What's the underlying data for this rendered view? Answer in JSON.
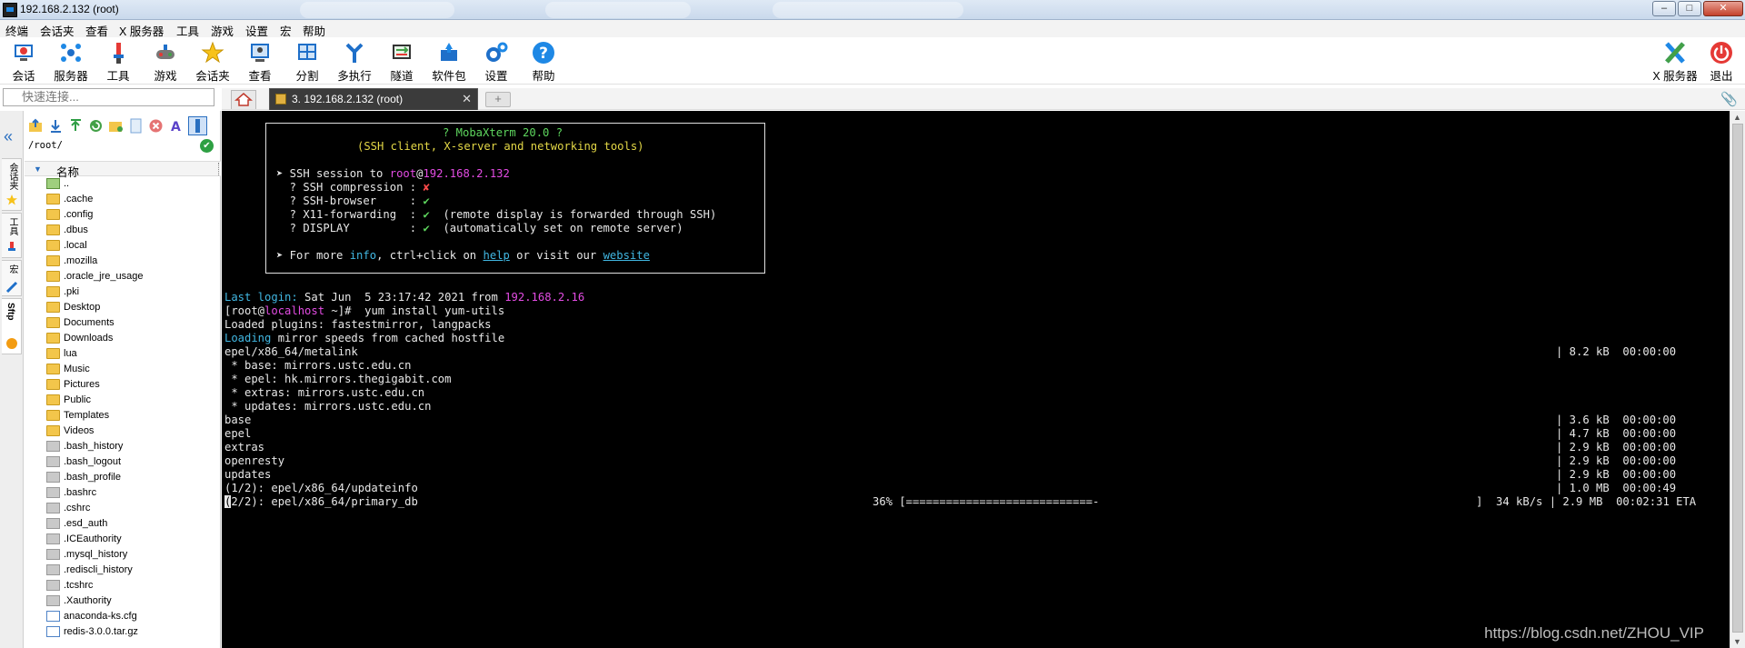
{
  "window": {
    "title": "192.168.2.132 (root)",
    "controls": {
      "minimize": "–",
      "maximize": "□",
      "close": "✕"
    }
  },
  "menubar": {
    "items": [
      "终端",
      "会话夹",
      "查看",
      "X 服务器",
      "工具",
      "游戏",
      "设置",
      "宏",
      "帮助"
    ]
  },
  "toolbar": {
    "buttons": [
      {
        "label": "会话",
        "icon": "session-icon"
      },
      {
        "label": "服务器",
        "icon": "servers-icon"
      },
      {
        "label": "工具",
        "icon": "tools-icon"
      },
      {
        "label": "游戏",
        "icon": "games-icon"
      },
      {
        "label": "会话夹",
        "icon": "star-icon"
      },
      {
        "label": "查看",
        "icon": "view-icon"
      },
      {
        "label": "分割",
        "icon": "split-icon"
      },
      {
        "label": "多执行",
        "icon": "multiexec-icon"
      },
      {
        "label": "隧道",
        "icon": "tunnel-icon"
      },
      {
        "label": "软件包",
        "icon": "packages-icon"
      },
      {
        "label": "设置",
        "icon": "settings-icon"
      },
      {
        "label": "帮助",
        "icon": "help-icon"
      }
    ],
    "right_buttons": [
      {
        "label": "X 服务器",
        "icon": "xserver-icon"
      },
      {
        "label": "退出",
        "icon": "power-icon"
      }
    ]
  },
  "quick_connect": {
    "placeholder": "快速连接..."
  },
  "tabs": {
    "active_session_label": "3. 192.168.2.132 (root)",
    "close_glyph": "✕",
    "new_tab_glyph": "+"
  },
  "left_strip": {
    "tabs": [
      {
        "label": "会话夹",
        "icon": "star-icon"
      },
      {
        "label": "工具",
        "icon": "tools-icon"
      },
      {
        "label": "宏",
        "icon": "macro-icon"
      },
      {
        "label": "Sftp",
        "icon": "sftp-icon"
      }
    ]
  },
  "sftp": {
    "path": "/root/",
    "column_header": "名称",
    "files": [
      {
        "name": "..",
        "type": "up"
      },
      {
        "name": ".cache",
        "type": "folder"
      },
      {
        "name": ".config",
        "type": "folder"
      },
      {
        "name": ".dbus",
        "type": "folder"
      },
      {
        "name": ".local",
        "type": "folder"
      },
      {
        "name": ".mozilla",
        "type": "folder"
      },
      {
        "name": ".oracle_jre_usage",
        "type": "folder"
      },
      {
        "name": ".pki",
        "type": "folder"
      },
      {
        "name": "Desktop",
        "type": "folder"
      },
      {
        "name": "Documents",
        "type": "folder"
      },
      {
        "name": "Downloads",
        "type": "folder"
      },
      {
        "name": "lua",
        "type": "folder"
      },
      {
        "name": "Music",
        "type": "folder"
      },
      {
        "name": "Pictures",
        "type": "folder"
      },
      {
        "name": "Public",
        "type": "folder"
      },
      {
        "name": "Templates",
        "type": "folder"
      },
      {
        "name": "Videos",
        "type": "folder"
      },
      {
        "name": ".bash_history",
        "type": "file"
      },
      {
        "name": ".bash_logout",
        "type": "file"
      },
      {
        "name": ".bash_profile",
        "type": "file"
      },
      {
        "name": ".bashrc",
        "type": "file"
      },
      {
        "name": ".cshrc",
        "type": "file"
      },
      {
        "name": ".esd_auth",
        "type": "file"
      },
      {
        "name": ".ICEauthority",
        "type": "file"
      },
      {
        "name": ".mysql_history",
        "type": "file"
      },
      {
        "name": ".rediscli_history",
        "type": "file"
      },
      {
        "name": ".tcshrc",
        "type": "file"
      },
      {
        "name": ".Xauthority",
        "type": "file"
      },
      {
        "name": "anaconda-ks.cfg",
        "type": "doc"
      },
      {
        "name": "redis-3.0.0.tar.gz",
        "type": "doc"
      }
    ]
  },
  "terminal": {
    "banner": {
      "line1": "? MobaXterm 20.0 ?",
      "line2": "(SSH client, X-server and networking tools)",
      "ssh_prefix": "➤ SSH session to ",
      "ssh_user": "root",
      "ssh_at": "@",
      "ssh_host": "192.168.2.132",
      "compression_label": "  ? SSH compression : ",
      "compression_value": "✘",
      "browser_label": "  ? SSH-browser     : ",
      "browser_value": "✔",
      "x11_label": "  ? X11-forwarding  : ",
      "x11_value": "✔",
      "x11_note": "  (remote display is forwarded through SSH)",
      "display_label": "  ? DISPLAY         : ",
      "display_value": "✔",
      "display_note": "  (automatically set on remote server)",
      "more_prefix": "➤ For more ",
      "more_info": "info",
      "more_mid": ", ctrl+click on ",
      "more_help": "help",
      "more_or": " or visit our ",
      "more_website": "website"
    },
    "last_login_label": "Last login:",
    "last_login_value": " Sat Jun  5 23:17:42 2021 from ",
    "last_login_host": "192.168.2.16",
    "prompt_open": "[root@",
    "prompt_host": "localhost",
    "prompt_close": " ~]#  yum install yum-utils",
    "loaded_plugins": "Loaded plugins: fastestmirror, langpacks",
    "loading_word": "Loading",
    "loading_rest": " mirror speeds from cached hostfile",
    "metalink": "epel/x86_64/metalink",
    "metalink_stat": "| 8.2 kB  00:00:00",
    "mirror_base": " * base: mirrors.ustc.edu.cn",
    "mirror_epel": " * epel: hk.mirrors.thegigabit.com",
    "mirror_extras": " * extras: mirrors.ustc.edu.cn",
    "mirror_updates": " * updates: mirrors.ustc.edu.cn",
    "repos": [
      {
        "name": "base",
        "stat": "| 3.6 kB  00:00:00"
      },
      {
        "name": "epel",
        "stat": "| 4.7 kB  00:00:00"
      },
      {
        "name": "extras",
        "stat": "| 2.9 kB  00:00:00"
      },
      {
        "name": "openresty",
        "stat": "| 2.9 kB  00:00:00"
      },
      {
        "name": "updates",
        "stat": "| 2.9 kB  00:00:00"
      },
      {
        "name": "(1/2): epel/x86_64/updateinfo",
        "stat": "| 1.0 MB  00:00:49"
      }
    ],
    "progress_cursor": "(",
    "progress_name": "2/2): epel/x86_64/primary_db",
    "progress_pct": "36% [============================-",
    "progress_tail": "]  34 kB/s | 2.9 MB  00:02:31 ETA"
  },
  "watermark": "https://blog.csdn.net/ZHOU_VIP"
}
